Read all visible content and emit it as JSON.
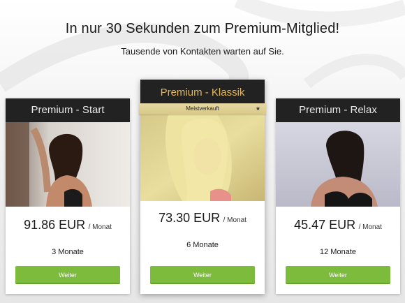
{
  "headline": "In nur 30 Sekunden zum Premium-Mitglied!",
  "subline": "Tausende von Kontakten warten auf Sie.",
  "plans": [
    {
      "title": "Premium - Start",
      "price": "91.86 EUR",
      "per": "/ Monat",
      "duration": "3 Monate",
      "button": "Weiter"
    },
    {
      "title": "Premium - Klassik",
      "badge": "Meistverkauft",
      "badge_icon": "star-icon",
      "price": "73.30 EUR",
      "per": "/ Monat",
      "duration": "6 Monate",
      "button": "Weiter"
    },
    {
      "title": "Premium - Relax",
      "price": "45.47 EUR",
      "per": "/ Monat",
      "duration": "12 Monate",
      "button": "Weiter"
    }
  ],
  "colors": {
    "header_bg": "#222222",
    "featured_title": "#e3b75a",
    "badge_bg": "#ddcd8d",
    "button_bg": "#7cbb3c"
  }
}
